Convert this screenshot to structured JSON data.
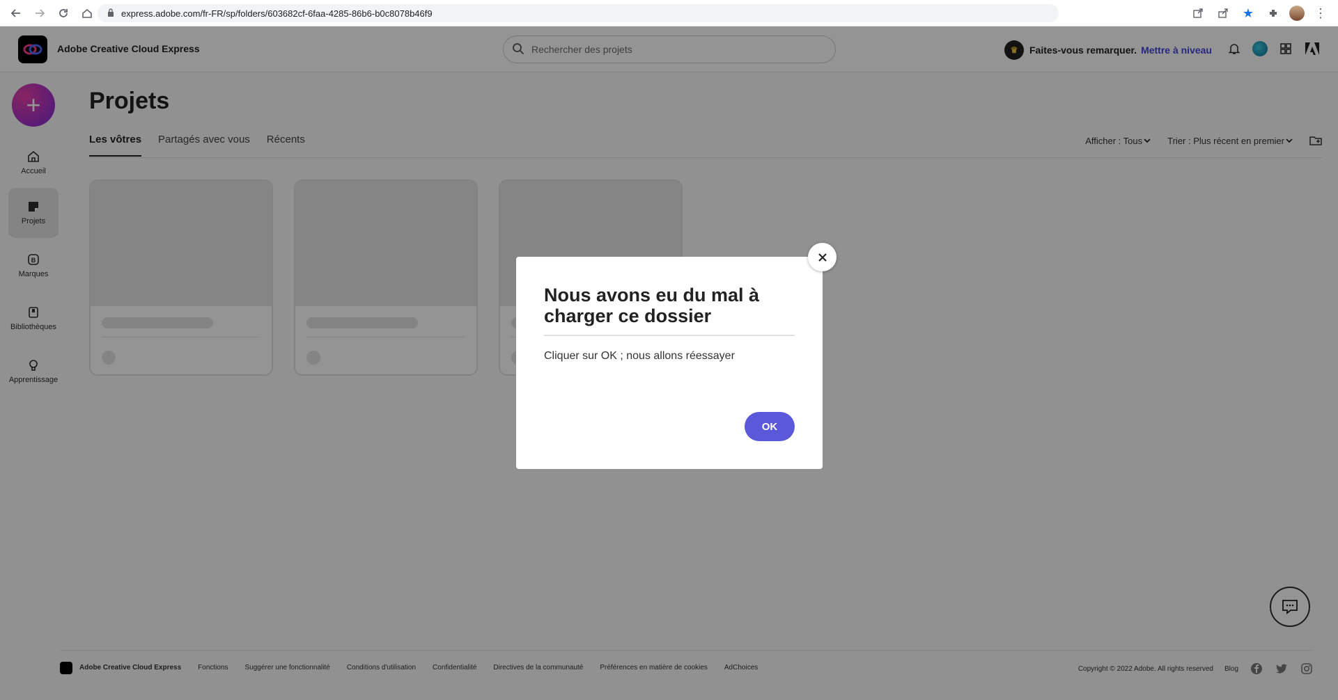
{
  "browser": {
    "url": "express.adobe.com/fr-FR/sp/folders/603682cf-6faa-4285-86b6-b0c8078b46f9"
  },
  "header": {
    "brand": "Adobe Creative Cloud Express",
    "search_placeholder": "Rechercher des projets",
    "promo_text": "Faites-vous remarquer.",
    "upgrade_link": "Mettre à niveau"
  },
  "sidebar": {
    "items": [
      {
        "label": "Accueil",
        "icon": "home-icon"
      },
      {
        "label": "Projets",
        "icon": "projects-icon",
        "active": true
      },
      {
        "label": "Marques",
        "icon": "brands-icon"
      },
      {
        "label": "Bibliothèques",
        "icon": "libraries-icon"
      },
      {
        "label": "Apprentissage",
        "icon": "learn-icon"
      }
    ]
  },
  "main": {
    "title": "Projets",
    "tabs": [
      {
        "label": "Les vôtres",
        "active": true
      },
      {
        "label": "Partagés avec vous"
      },
      {
        "label": "Récents"
      }
    ],
    "filter_show": "Afficher : Tous",
    "filter_sort": "Trier : Plus récent en premier"
  },
  "dialog": {
    "title": "Nous avons eu du mal à charger ce dossier",
    "body": "Cliquer sur OK ; nous allons réessayer",
    "ok_label": "OK"
  },
  "footer": {
    "brand": "Adobe Creative Cloud Express",
    "links": [
      "Fonctions",
      "Suggérer une fonctionnalité",
      "Conditions d'utilisation",
      "Confidentialité",
      "Directives de la communauté",
      "Préférences en matière de cookies",
      "AdChoices"
    ],
    "copyright": "Copyright © 2022 Adobe. All rights reserved",
    "blog": "Blog"
  },
  "colors": {
    "accent": "#5b58d9",
    "upgrade": "#4b43d9",
    "create_button": "#9b2fd0"
  }
}
